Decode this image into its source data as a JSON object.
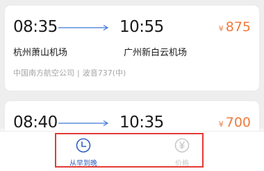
{
  "flights": [
    {
      "departure_time": "08:35",
      "arrival_time": "10:55",
      "currency_symbol": "¥",
      "price": "875",
      "departure_airport": "杭州萧山机场",
      "arrival_airport": "广州新白云机场",
      "airline": "中国南方航空公司",
      "separator": "|",
      "aircraft": "波音737(中)"
    },
    {
      "departure_time": "08:40",
      "arrival_time": "10:35",
      "currency_symbol": "¥",
      "price": "700"
    }
  ],
  "sort_tabs": [
    {
      "label": "从早到晚",
      "icon": "clock-icon",
      "active": true
    },
    {
      "label": "价格",
      "icon": "yen-icon",
      "active": false
    }
  ],
  "colors": {
    "price": "#f07a3c",
    "active_tab": "#2f5fc4",
    "inactive_tab": "#c8c8c8",
    "arrow": "#3b78d8",
    "highlight_box": "#e53935"
  }
}
